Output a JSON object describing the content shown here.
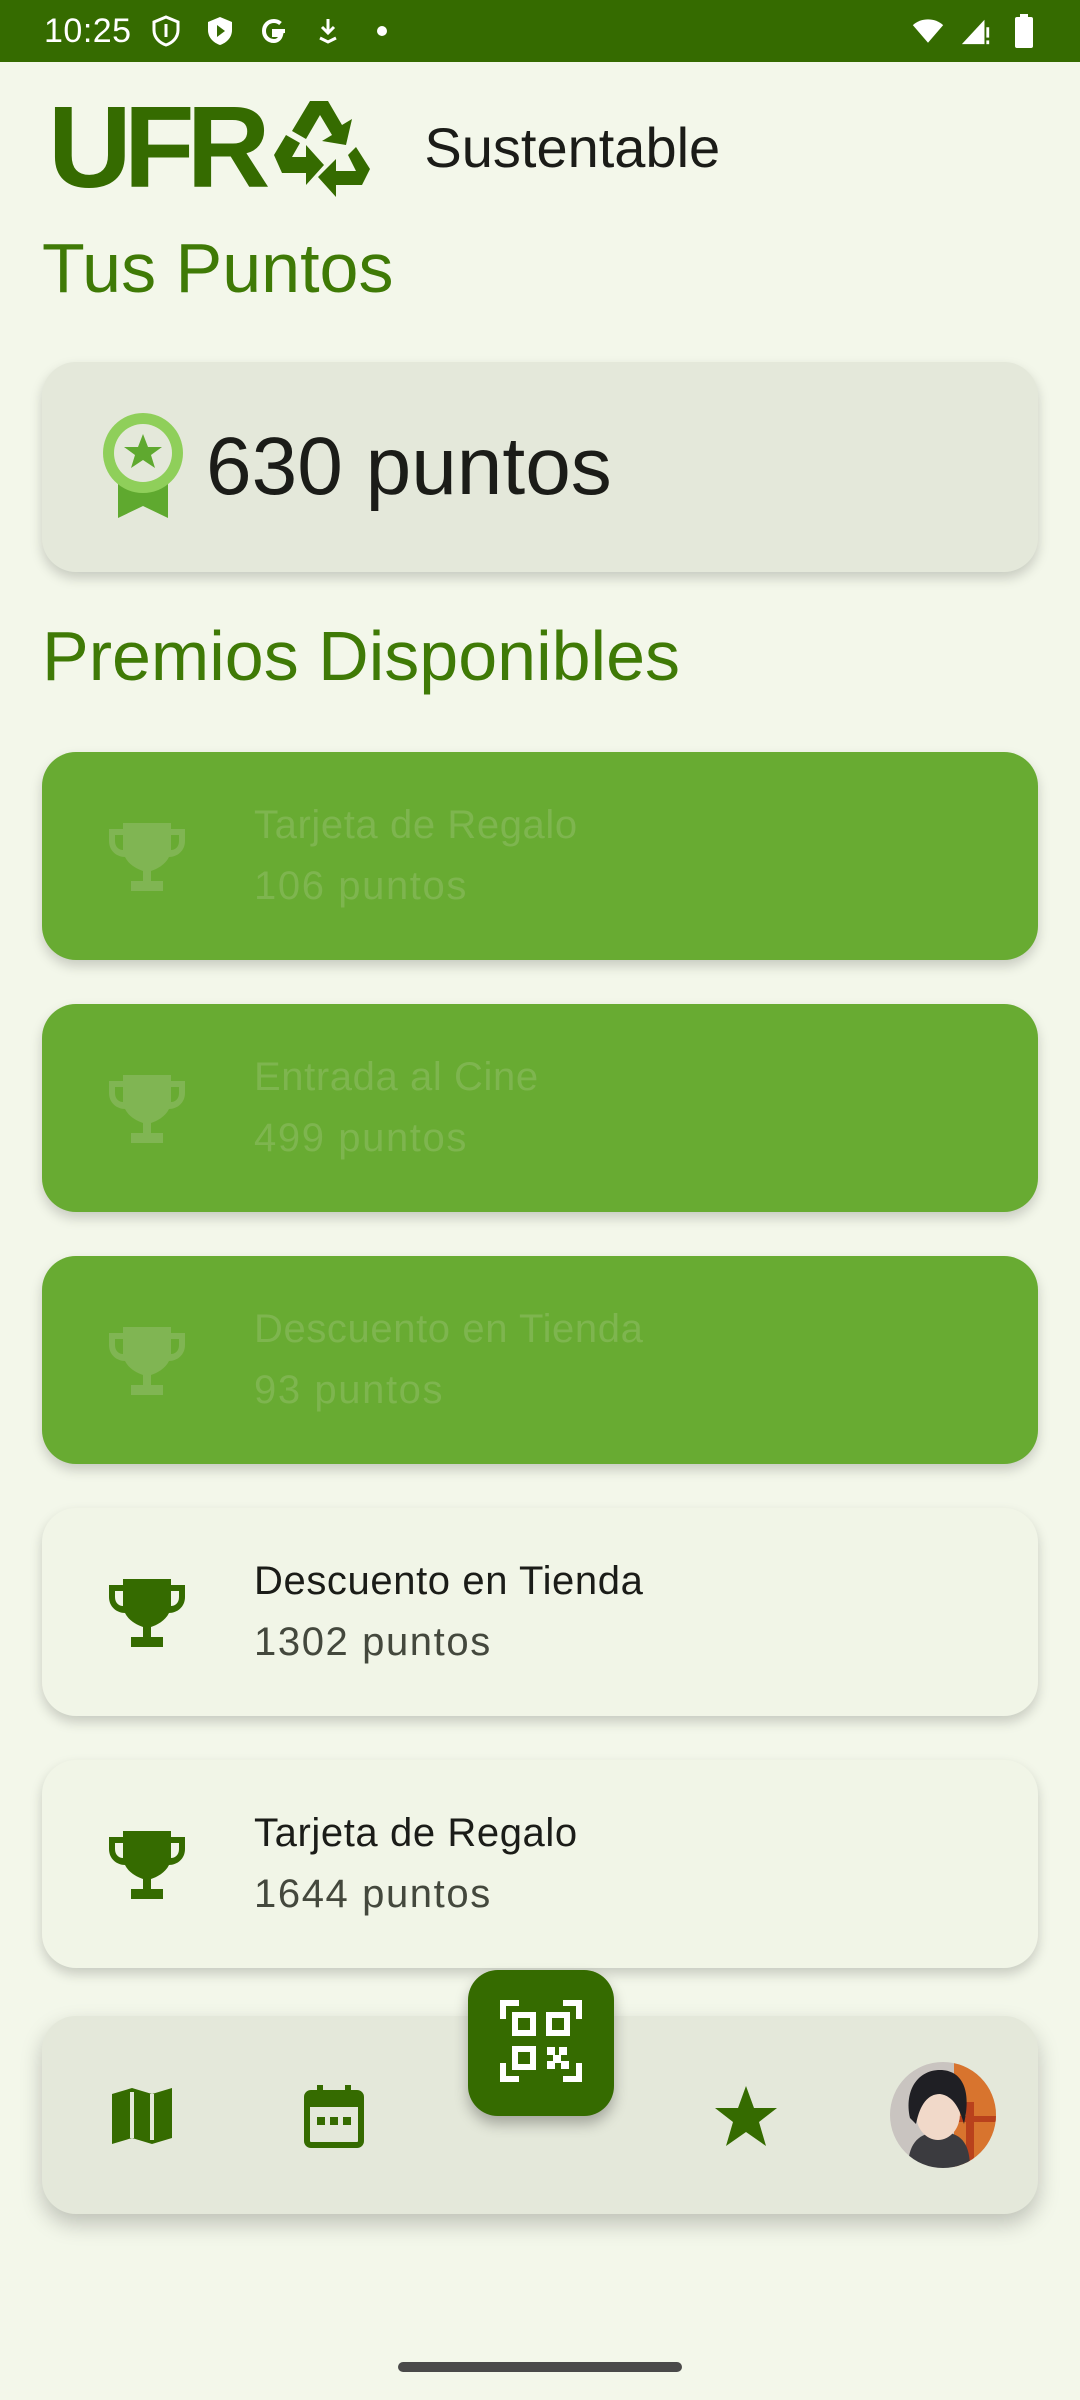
{
  "status_bar": {
    "time": "10:25",
    "icons_left": [
      "shield-icon",
      "play-protect-icon",
      "google-icon",
      "download-icon",
      "dot-icon"
    ],
    "icons_right": [
      "wifi-icon",
      "signal-icon",
      "battery-icon"
    ]
  },
  "header": {
    "logo_text": "UFR",
    "subtitle": "Sustentable"
  },
  "points_section": {
    "title": "Tus Puntos",
    "value": "630 puntos",
    "icon": "award-icon"
  },
  "prizes_section": {
    "title": "Premios Disponibles",
    "items": [
      {
        "name": "Tarjeta de Regalo",
        "points": "106 puntos",
        "state": "locked"
      },
      {
        "name": "Entrada al Cine",
        "points": "499 puntos",
        "state": "locked"
      },
      {
        "name": "Descuento en Tienda",
        "points": "93 puntos",
        "state": "locked"
      },
      {
        "name": "Descuento en Tienda",
        "points": "1302 puntos",
        "state": "available"
      },
      {
        "name": "Tarjeta de Regalo",
        "points": "1644 puntos",
        "state": "available"
      }
    ]
  },
  "bottom_nav": {
    "items": [
      "map-icon",
      "calendar-icon",
      "qr-scan-icon",
      "star-icon",
      "avatar"
    ]
  },
  "colors": {
    "primary": "#356b00",
    "locked_card": "#68ab32",
    "background": "#f3f7ea",
    "surface": "#e4e8da"
  }
}
